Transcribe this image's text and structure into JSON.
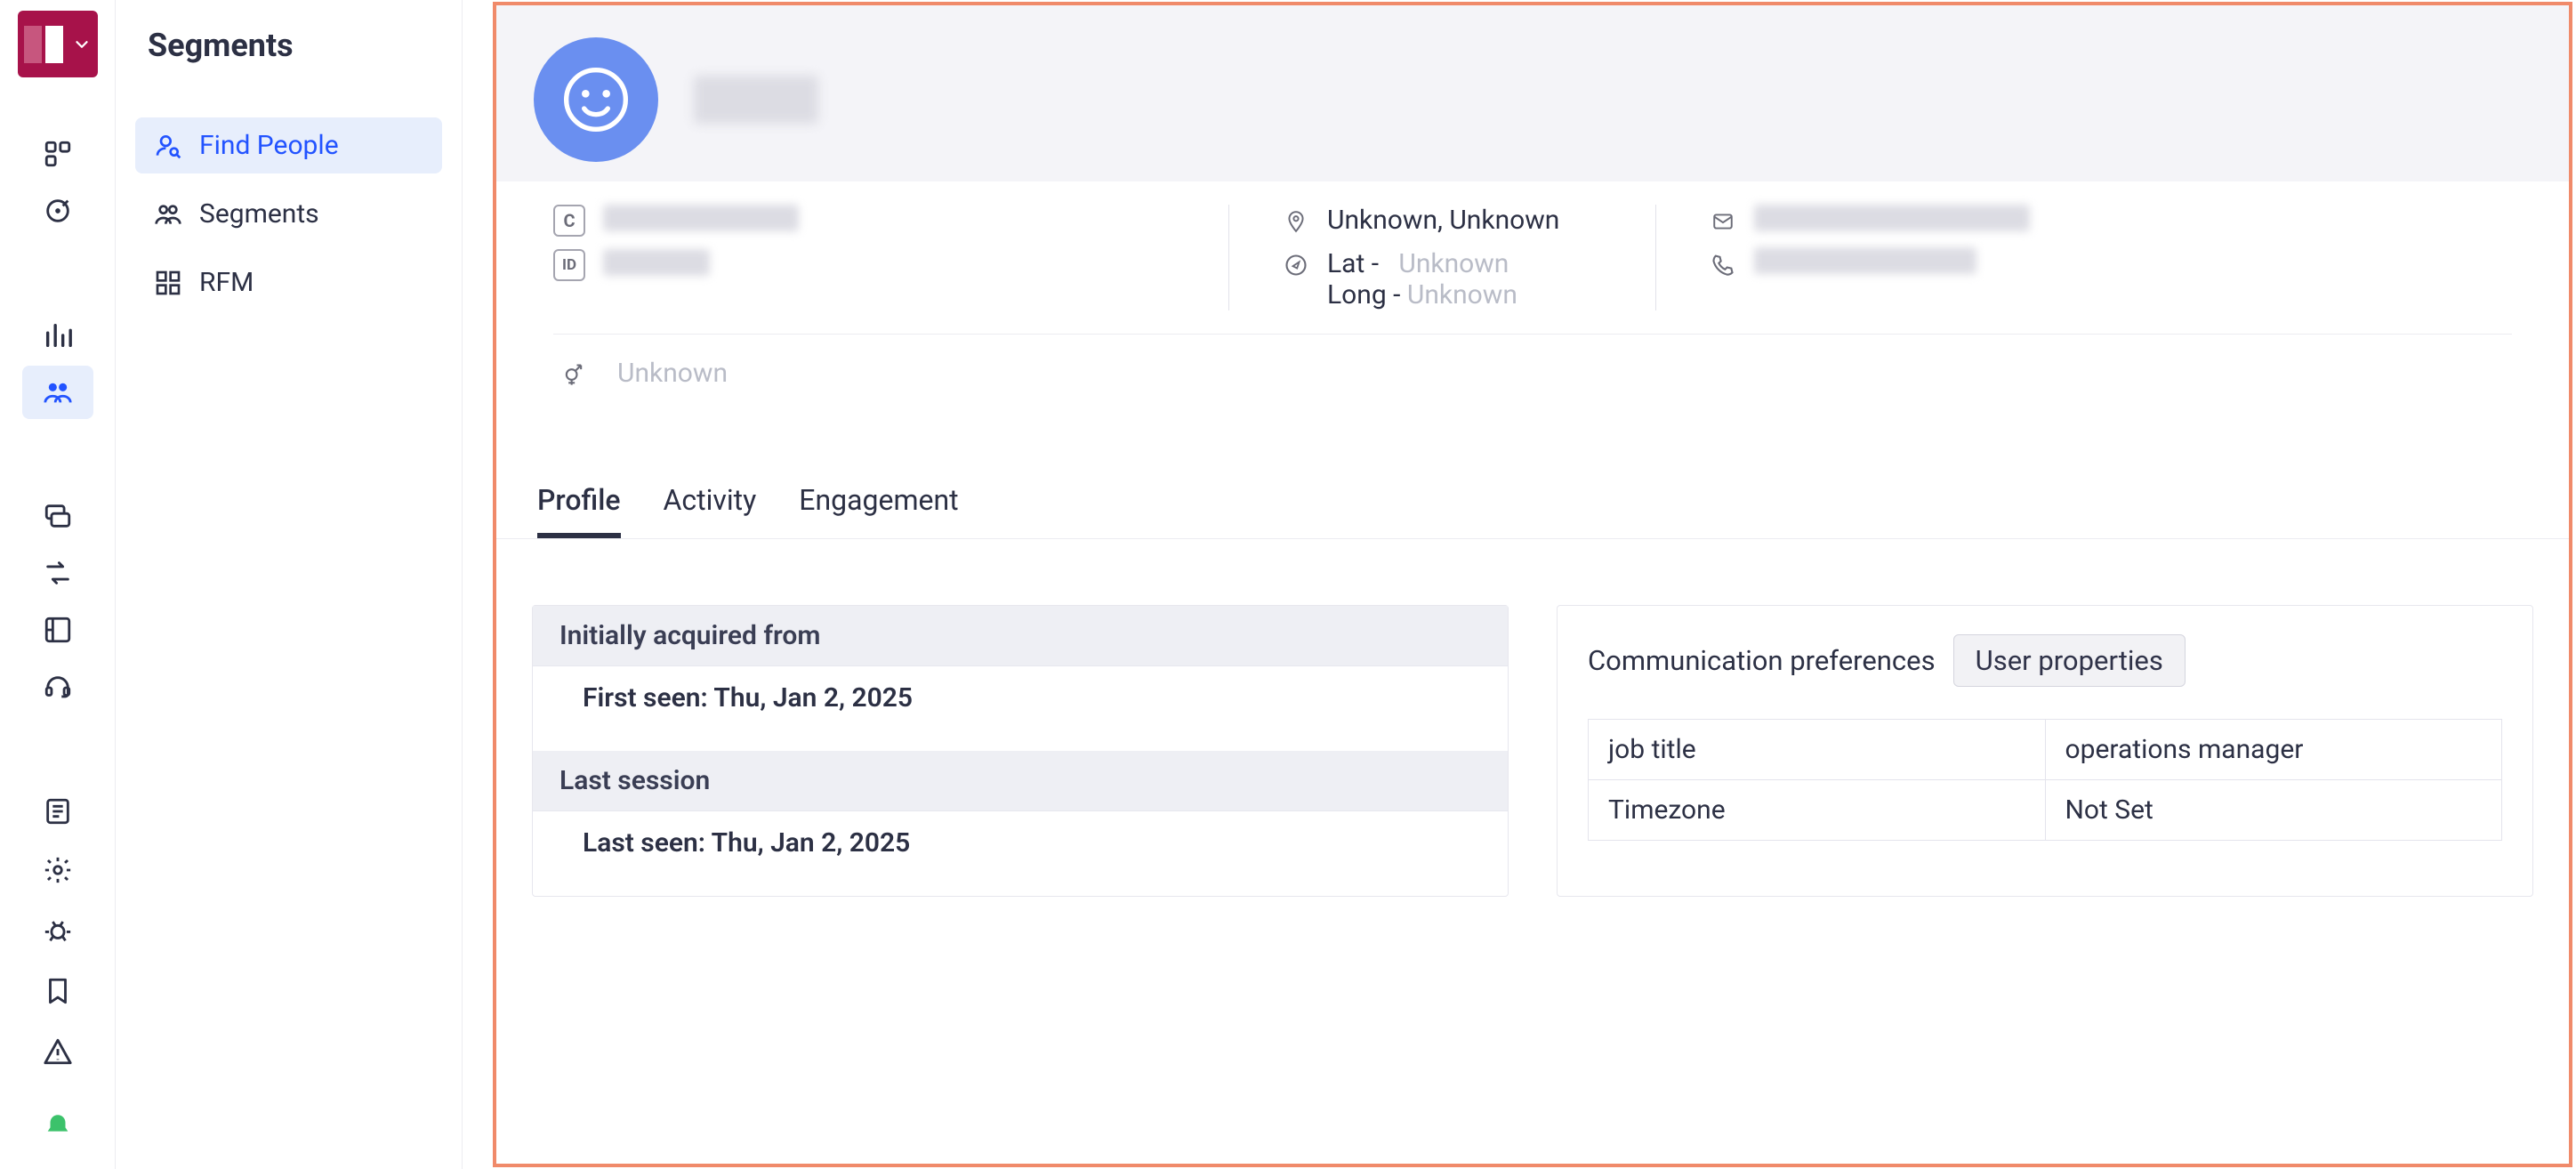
{
  "sidebar": {
    "title": "Segments",
    "items": [
      {
        "label": "Find People",
        "active": true
      },
      {
        "label": "Segments",
        "active": false
      },
      {
        "label": "RFM",
        "active": false
      }
    ]
  },
  "profile": {
    "location": "Unknown, Unknown",
    "lat_label": "Lat -",
    "lat_value": "Unknown",
    "long_label": "Long -",
    "long_value": "Unknown",
    "gender": "Unknown"
  },
  "tabs": [
    {
      "label": "Profile",
      "active": true
    },
    {
      "label": "Activity",
      "active": false
    },
    {
      "label": "Engagement",
      "active": false
    }
  ],
  "timeline": {
    "acquired_header": "Initially acquired from",
    "first_seen": "First seen: Thu, Jan 2, 2025",
    "last_session_header": "Last session",
    "last_seen": "Last seen: Thu, Jan 2, 2025"
  },
  "props": {
    "comm_pref_label": "Communication preferences",
    "user_props_label": "User properties",
    "rows": [
      {
        "k": "job title",
        "v": "operations manager"
      },
      {
        "k": "Timezone",
        "v": "Not Set"
      }
    ]
  }
}
